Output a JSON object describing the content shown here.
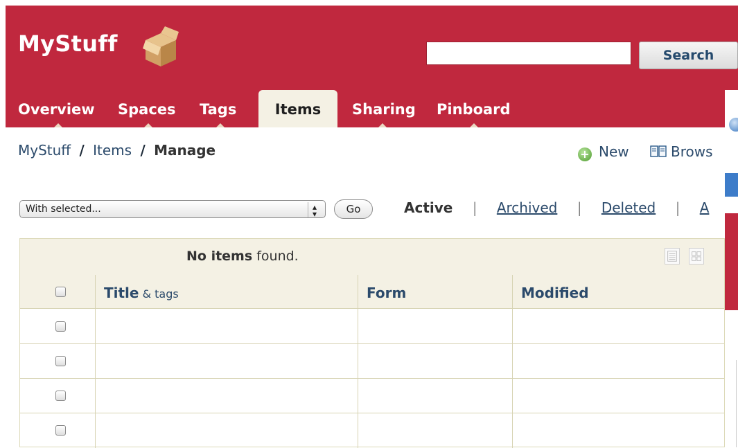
{
  "brand": {
    "name": "MyStuff",
    "color_header": "#c0283e",
    "color_link": "#2b4a6b"
  },
  "search": {
    "value": "",
    "button_label": "Search"
  },
  "tabs": [
    {
      "label": "Overview",
      "active": false
    },
    {
      "label": "Spaces",
      "active": false
    },
    {
      "label": "Tags",
      "active": false
    },
    {
      "label": "Items",
      "active": true
    },
    {
      "label": "Sharing",
      "active": false
    },
    {
      "label": "Pinboard",
      "active": false
    }
  ],
  "breadcrumb": {
    "root": "MyStuff",
    "sep": "/",
    "section": "Items",
    "current": "Manage"
  },
  "actions": {
    "new_label": "New",
    "browse_label": "Brows",
    "new_icon": "plus-circle-icon",
    "browse_icon": "book-icon"
  },
  "bulk": {
    "select_value": "With selected...",
    "go_label": "Go"
  },
  "filters": {
    "active": "Active",
    "archived": "Archived",
    "deleted": "Deleted",
    "all": "A",
    "divider": "|"
  },
  "table": {
    "status_bold": "No items",
    "status_rest": " found.",
    "columns": {
      "title": "Title",
      "title_suffix": " & tags",
      "form": "Form",
      "modified": "Modified"
    },
    "row_count": 4
  }
}
